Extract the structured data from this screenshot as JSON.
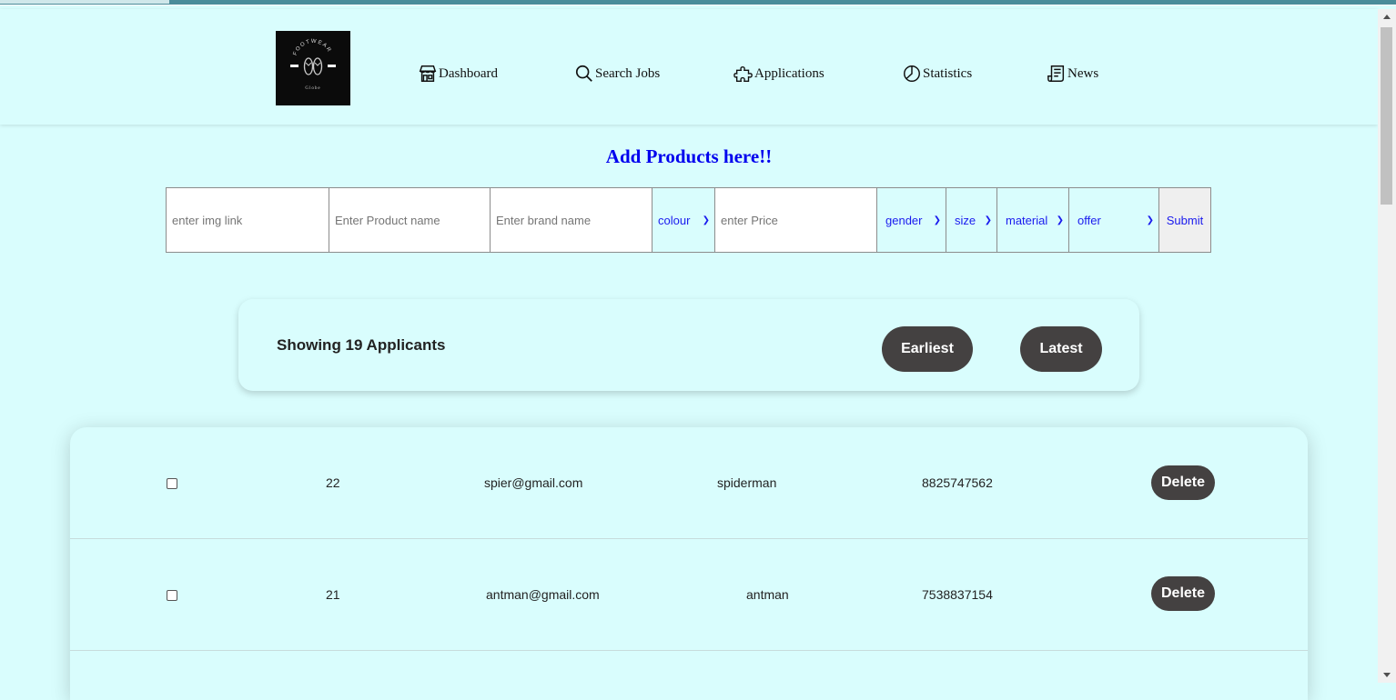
{
  "logo": {
    "top_text": "FOOTWEAR",
    "bottom_text": "Globe",
    "icon": "flip-flops-logo"
  },
  "nav": [
    {
      "label": "Dashboard",
      "icon": "store-icon"
    },
    {
      "label": "Search Jobs",
      "icon": "search-icon"
    },
    {
      "label": "Applications",
      "icon": "puzzle-icon"
    },
    {
      "label": "Statistics",
      "icon": "pie-chart-icon"
    },
    {
      "label": "News",
      "icon": "news-icon"
    }
  ],
  "form": {
    "title": "Add Products here!!",
    "img_placeholder": "enter img link",
    "name_placeholder": "Enter Product name",
    "brand_placeholder": "Enter brand name",
    "colour": "colour",
    "price_placeholder": "enter Price",
    "gender": "gender",
    "size": "size",
    "material": "material",
    "offer": "offer",
    "submit": "Submit"
  },
  "summary": {
    "count_text": "Showing 19 Applicants",
    "earliest": "Earliest",
    "latest": "Latest"
  },
  "rows": [
    {
      "id": "22",
      "email": "spier@gmail.com",
      "name": "spiderman",
      "phone": "8825747562",
      "action": "Delete"
    },
    {
      "id": "21",
      "email": "antman@gmail.com",
      "name": "antman",
      "phone": "7538837154",
      "action": "Delete"
    }
  ],
  "colors": {
    "background": "#d9fdfd",
    "title": "#0000ee",
    "pill": "#444141"
  }
}
